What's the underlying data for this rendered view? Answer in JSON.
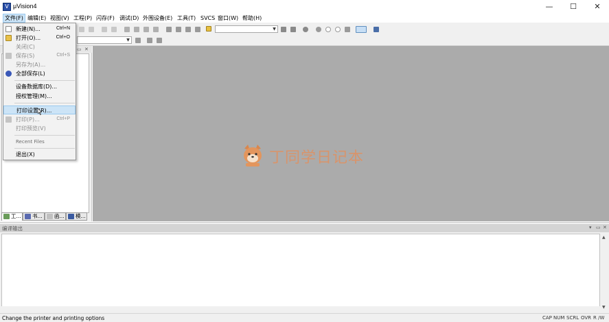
{
  "window": {
    "title": "μVision4",
    "app_icon": "V",
    "controls": {
      "minimize": "—",
      "maximize": "☐",
      "close": "✕"
    }
  },
  "menubar": {
    "items": [
      {
        "label": "文件(F)",
        "active": true
      },
      {
        "label": "编辑(E)"
      },
      {
        "label": "视图(V)"
      },
      {
        "label": "工程(P)"
      },
      {
        "label": "闪存(F)"
      },
      {
        "label": "调试(D)"
      },
      {
        "label": "外围设备(E)"
      },
      {
        "label": "工具(T)"
      },
      {
        "label": "SVCS"
      },
      {
        "label": "窗口(W)"
      },
      {
        "label": "帮助(H)"
      }
    ]
  },
  "file_menu": {
    "items": [
      {
        "label": "新建(N)...",
        "shortcut": "Ctrl+N",
        "icon": "new-file-icon",
        "enabled": true
      },
      {
        "label": "打开(O)...",
        "shortcut": "Ctrl+O",
        "icon": "open-folder-icon",
        "enabled": true
      },
      {
        "label": "关闭(C)",
        "shortcut": "",
        "enabled": false
      },
      {
        "label": "保存(S)",
        "shortcut": "Ctrl+S",
        "icon": "save-icon",
        "enabled": false
      },
      {
        "label": "另存为(A)...",
        "shortcut": "",
        "enabled": false
      },
      {
        "label": "全部保存(L)",
        "shortcut": "",
        "icon": "save-all-icon",
        "enabled": true
      },
      {
        "label": "设备数据库(D)...",
        "shortcut": "",
        "enabled": true
      },
      {
        "label": "授权管理(M)...",
        "shortcut": "",
        "enabled": true
      },
      {
        "label": "打印设置(R)...",
        "shortcut": "",
        "enabled": true,
        "highlighted": true
      },
      {
        "label": "打印(P)...",
        "shortcut": "Ctrl+P",
        "icon": "print-icon",
        "enabled": false
      },
      {
        "label": "打印预览(V)",
        "shortcut": "",
        "enabled": false
      },
      {
        "label": "退出(X)",
        "shortcut": "",
        "enabled": true
      }
    ],
    "recent_files_label": "Recent Files"
  },
  "project_panel": {
    "tabs": [
      {
        "label": "工...",
        "icon": "project-icon"
      },
      {
        "label": "书...",
        "icon": "books-icon"
      },
      {
        "label": "函...",
        "icon": "functions-icon"
      },
      {
        "label": "模...",
        "icon": "templates-icon"
      }
    ]
  },
  "watermark": {
    "text": "丁同学日记本"
  },
  "output_panel": {
    "title": "编译输出"
  },
  "statusbar": {
    "message": "Change the printer and printing options",
    "indicators": [
      "CAP",
      "NUM",
      "SCRL",
      "OVR",
      "R /W"
    ]
  },
  "colors": {
    "editor_bg": "#ababab",
    "menu_highlight": "#cce4f7",
    "watermark": "#e09060"
  }
}
